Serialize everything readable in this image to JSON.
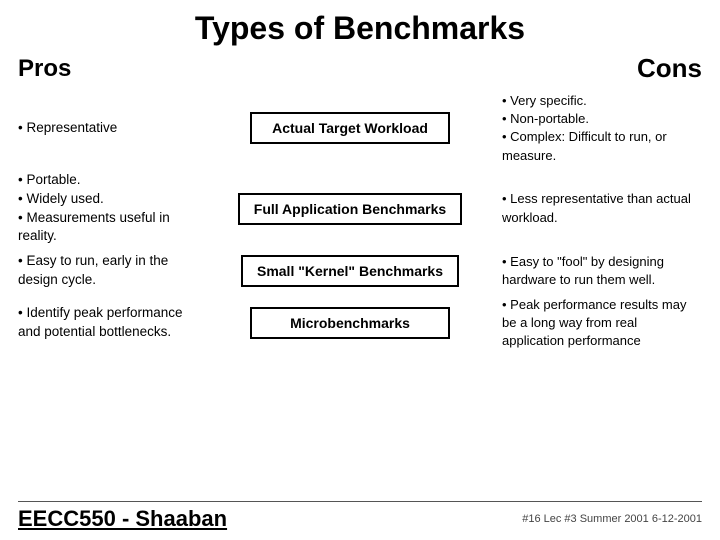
{
  "header": {
    "title": "Types of Benchmarks",
    "pros": "Pros",
    "cons": "Cons"
  },
  "rows": [
    {
      "pros_text": "• Representative",
      "benchmark_label": "Actual Target Workload",
      "cons_text": "• Very specific.\n• Non-portable.\n• Complex: Difficult to run, or measure."
    },
    {
      "pros_text": "• Portable.\n• Widely used.\n• Measurements useful in reality.",
      "benchmark_label": "Full Application Benchmarks",
      "cons_text": "• Less representative than actual workload."
    },
    {
      "pros_text": "• Easy to run, early in the design cycle.",
      "benchmark_label": "Small \"Kernel\" Benchmarks",
      "cons_text": "• Easy to \"fool\" by designing hardware to run them well."
    },
    {
      "pros_text": "• Identify peak performance and potential bottlenecks.",
      "benchmark_label": "Microbenchmarks",
      "cons_text": "• Peak performance results may be a long way from real application performance"
    }
  ],
  "footer": {
    "title": "EECC550 - Shaaban",
    "info_line1": "#16  Lec #3   Summer 2001   6-12-2001"
  }
}
